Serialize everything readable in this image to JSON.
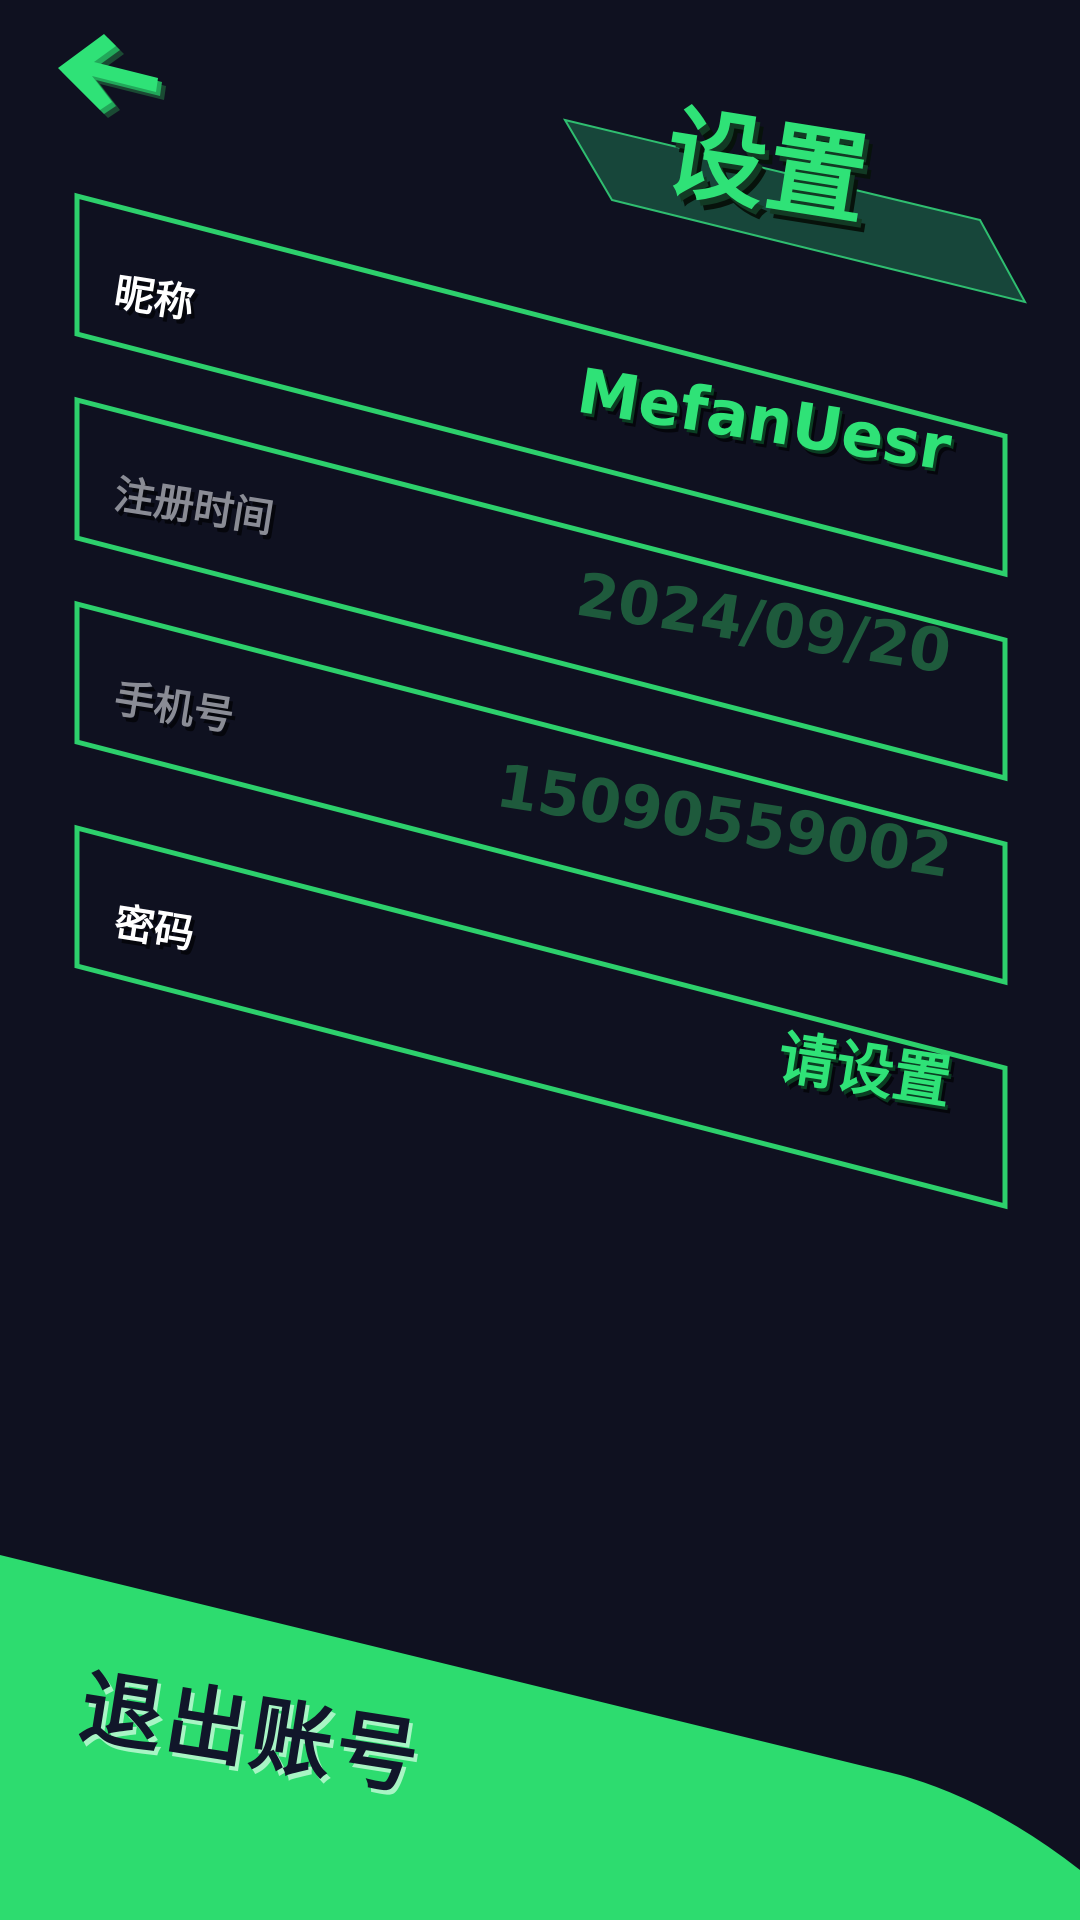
{
  "header": {
    "title": "设置",
    "back_icon": "arrow-left-icon"
  },
  "fields": [
    {
      "label": "昵称",
      "value": "MefanUesr",
      "editable": true
    },
    {
      "label": "注册时间",
      "value": "2024/09/20",
      "editable": false
    },
    {
      "label": "手机号",
      "value": "15090559002",
      "editable": false
    },
    {
      "label": "密码",
      "value": "请设置",
      "editable": true
    }
  ],
  "footer": {
    "logout_label": "退出账号"
  },
  "colors": {
    "background": "#0f1120",
    "accent": "#2fe277",
    "accent_dark": "#1e5a3c",
    "label_active": "#ffffff",
    "label_muted": "#8a8c95"
  }
}
